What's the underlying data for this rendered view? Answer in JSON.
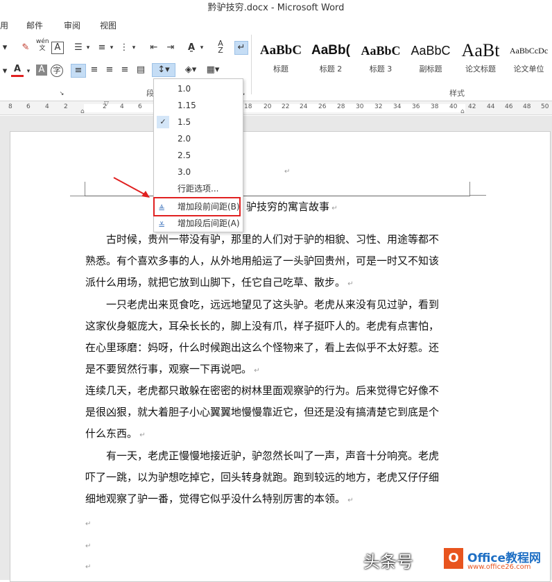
{
  "window": {
    "title": "黔驴技穷.docx - Microsoft Word"
  },
  "tabs": [
    "用",
    "邮件",
    "审阅",
    "视图"
  ],
  "ribbon": {
    "paragraph_group_label": "段",
    "styles_group_label": "样式",
    "styles": [
      {
        "preview": "AaBbC",
        "name": "标题"
      },
      {
        "preview": "AaBb(",
        "name": "标题 2"
      },
      {
        "preview": "AaBbC",
        "name": "标题 3"
      },
      {
        "preview": "AaBbC",
        "name": "副标题"
      },
      {
        "preview": "AaBt",
        "name": "论文标题"
      },
      {
        "preview": "AaBbCcDc",
        "name": "论文单位"
      }
    ],
    "phonetic_guide": "wén"
  },
  "ruler": {
    "numbers": [
      "8",
      "6",
      "4",
      "2",
      "2",
      "4",
      "6",
      "18",
      "20",
      "22",
      "24",
      "26",
      "28",
      "30",
      "32",
      "34",
      "36",
      "38",
      "40",
      "42",
      "44",
      "46",
      "48",
      "50"
    ]
  },
  "menu": {
    "items": [
      "1.0",
      "1.15",
      "1.5",
      "2.0",
      "2.5",
      "3.0",
      "行距选项..."
    ],
    "checked": "1.5",
    "add_before": "增加段前间距(B)",
    "add_after": "增加段后间距(A)"
  },
  "document": {
    "title_visible": "驴技穷的寓言故事",
    "paragraphs": [
      [
        "古时候，贵州一带没有驴，那里的人们对于驴的相貌、习性、用途等都不",
        "熟悉。有个喜欢多事的人，从外地用船运了一头驴回贵州，可是一时又不知该",
        "派什么用场，就把它放到山脚下，任它自己吃草、散步。"
      ],
      [
        "一只老虎出来觅食吃，远远地望见了这头驴。老虎从来没有见过驴，看到",
        "这家伙身躯庞大，耳朵长长的，脚上没有爪，样子挺吓人的。老虎有点害怕，",
        "在心里琢磨：妈呀，什么时候跑出这么个怪物来了，看上去似乎不太好惹。还",
        "是不要贸然行事，观察一下再说吧。"
      ],
      [
        "连续几天，老虎都只敢躲在密密的树林里面观察驴的行为。后来觉得它好像不",
        "是很凶狠，就大着胆子小心翼翼地慢慢靠近它，但还是没有搞清楚它到底是个",
        "什么东西。"
      ],
      [
        "有一天，老虎正慢慢地接近驴，驴忽然长叫了一声，声音十分响亮。老虎",
        "吓了一跳，以为驴想吃掉它，回头转身就跑。跑到较远的地方，老虎又仔仔细",
        "细地观察了驴一番，觉得它似乎没什么特别厉害的本领。"
      ]
    ]
  },
  "watermark": {
    "text1": "头条号",
    "text2": "Office教程网",
    "url": "www.office26.com"
  },
  "colors": {
    "accent": "#2b579a",
    "highlight": "#c5ddf5",
    "red": "#e02020"
  }
}
